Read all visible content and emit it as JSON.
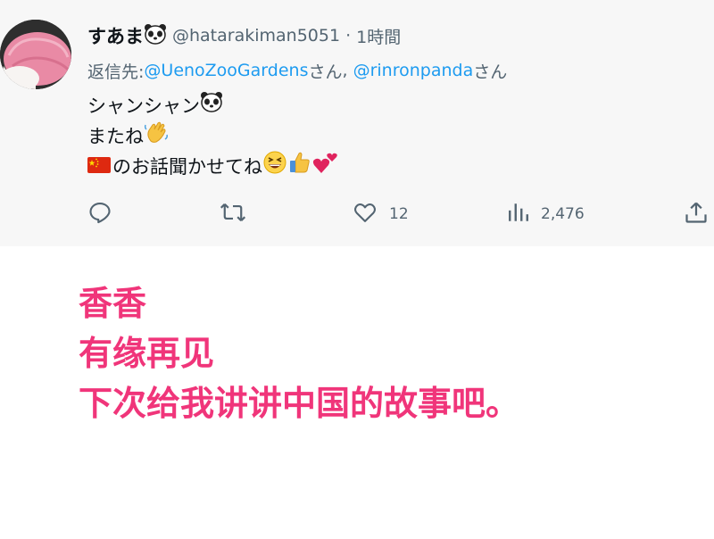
{
  "tweet": {
    "display_name": "すあま",
    "handle": "@hatarakiman5051",
    "separator": "·",
    "time": "1時間",
    "reply_prefix": "返信先: ",
    "mentions": [
      {
        "handle": "@UenoZooGardens",
        "suffix": "さん"
      },
      {
        "handle": "@rinronpanda",
        "suffix": "さん"
      }
    ],
    "mention_joiner": ", ",
    "lines": [
      {
        "text": "シャンシャン",
        "emojis": [
          "panda-face"
        ]
      },
      {
        "text": "またね",
        "emojis": [
          "waving-hand"
        ]
      },
      {
        "prefix_emoji": "china-flag",
        "text": "のお話聞かせてね",
        "emojis": [
          "grinning-squinting-face",
          "thumbs-up",
          "two-hearts"
        ]
      }
    ],
    "actions": {
      "reply": {
        "icon": "reply-icon"
      },
      "retweet": {
        "icon": "retweet-icon"
      },
      "like": {
        "icon": "heart-icon",
        "count": "12"
      },
      "views": {
        "icon": "views-icon",
        "count": "2,476"
      },
      "share": {
        "icon": "share-icon"
      }
    }
  },
  "caption": {
    "lines": [
      "香香",
      "有缘再见",
      "下次给我讲讲中国的故事吧。"
    ],
    "color": "#f0357a"
  },
  "colors": {
    "mention": "#1d9bf0",
    "secondary_text": "#536471",
    "tweet_background": "#f7f7f7"
  }
}
